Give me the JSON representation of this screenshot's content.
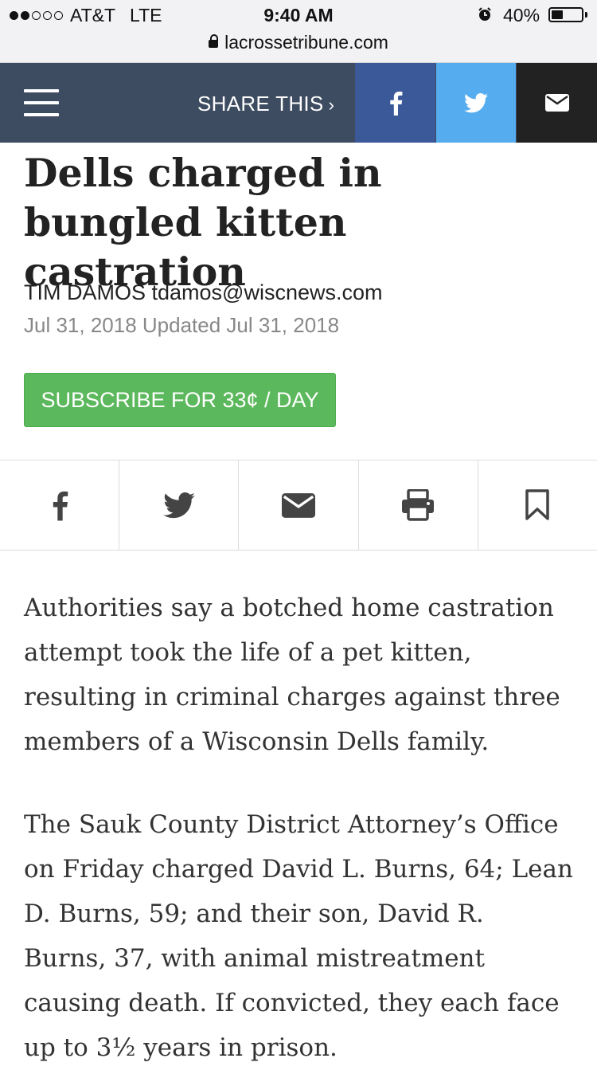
{
  "status_bar": {
    "carrier": "AT&T",
    "network": "LTE",
    "time": "9:40 AM",
    "battery_percent": "40%",
    "battery_level": 0.4,
    "signal_bars": 2,
    "icons": [
      "signal-dots-icon",
      "alarm-icon",
      "battery-icon",
      "lock-icon"
    ]
  },
  "browser": {
    "url": "lacrossetribune.com"
  },
  "header": {
    "share_label": "SHARE THIS",
    "share_chevron": "›",
    "social": [
      "facebook-icon",
      "twitter-icon",
      "email-icon"
    ],
    "colors": {
      "bar": "#3e4c61",
      "facebook": "#3b5998",
      "twitter": "#55acee",
      "email": "#222222"
    }
  },
  "article": {
    "headline": "Dells charged in bungled kitten castration",
    "byline": "TIM DAMOS tdamos@wiscnews.com",
    "dates": "Jul 31, 2018 Updated Jul 31, 2018",
    "subscribe_label": "SUBSCRIBE FOR 33¢ / DAY",
    "subscribe_color": "#5cb85c",
    "tools": [
      "facebook-icon",
      "twitter-icon",
      "email-icon",
      "print-icon",
      "bookmark-icon"
    ],
    "paragraphs": [
      "Authorities say a botched home castration attempt took the life of a pet kitten, resulting in criminal charges against three members of a Wisconsin Dells family.",
      "The Sauk County District Attorney’s Office on Friday charged David L. Burns, 64; Lean D. Burns, 59; and their son, David R. Burns, 37, with animal mistreatment causing death. If convicted, they each face up to 3½ years in prison."
    ]
  }
}
